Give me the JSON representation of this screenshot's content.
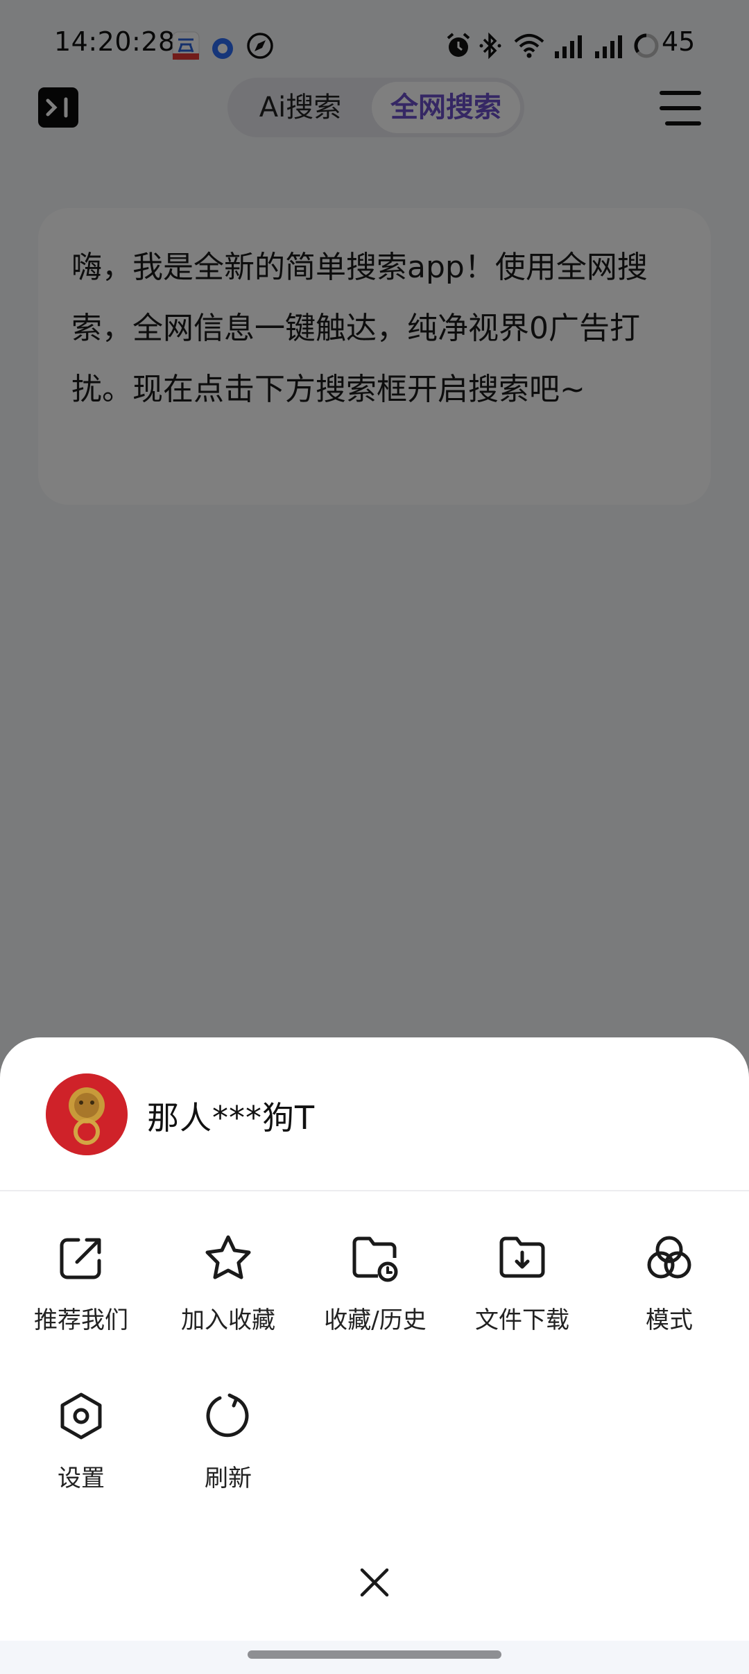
{
  "status_bar": {
    "time": "14:20:28",
    "battery": "45",
    "icons": [
      "cloud-app-icon",
      "blue-dot-app-icon",
      "compass-app-icon",
      "alarm-icon",
      "bluetooth-icon",
      "wifi-icon",
      "signal-icon",
      "signal-icon",
      "battery-ring-icon"
    ]
  },
  "header": {
    "logo_icon": "terminal-logo-icon",
    "tabs": [
      {
        "label": "Ai搜索",
        "selected": false
      },
      {
        "label": "全网搜索",
        "selected": true
      }
    ],
    "accent_color": "#6b4fc8",
    "menu_icon": "hamburger-menu-icon"
  },
  "chat": {
    "welcome_message": "嗨，我是全新的简单搜索app！使用全网搜索，全网信息一键触达，纯净视界0广告打扰。现在点击下方搜索框开启搜索吧~"
  },
  "sheet": {
    "user": {
      "name": "那人***狗T",
      "avatar_icon": "lion-door-knocker-avatar"
    },
    "items": [
      {
        "label": "推荐我们",
        "icon": "share-icon"
      },
      {
        "label": "加入收藏",
        "icon": "star-icon"
      },
      {
        "label": "收藏/历史",
        "icon": "folder-history-icon"
      },
      {
        "label": "文件下载",
        "icon": "folder-download-icon"
      },
      {
        "label": "模式",
        "icon": "circles-mode-icon"
      },
      {
        "label": "设置",
        "icon": "hexagon-settings-icon"
      },
      {
        "label": "刷新",
        "icon": "refresh-icon"
      }
    ],
    "close_icon": "close-icon"
  }
}
